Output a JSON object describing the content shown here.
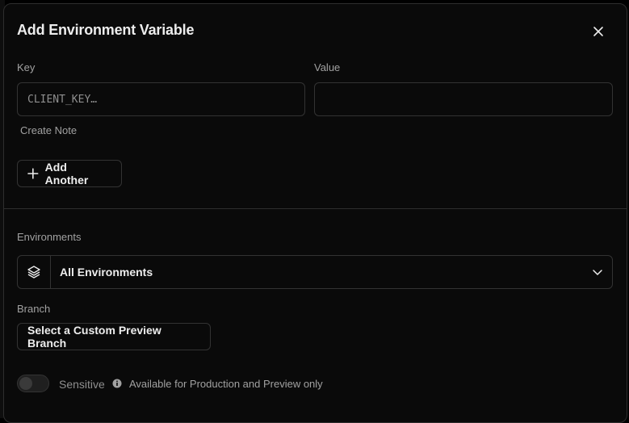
{
  "dialog": {
    "title": "Add Environment Variable",
    "close_icon": "close-icon"
  },
  "fields": {
    "key_label": "Key",
    "key_placeholder": "CLIENT_KEY…",
    "key_value": "",
    "value_label": "Value",
    "value_placeholder": "",
    "value_value": ""
  },
  "create_note": "Create Note",
  "add_another": {
    "label": "Add Another",
    "icon": "plus-icon"
  },
  "environments": {
    "label": "Environments",
    "selected": "All Environments",
    "icon": "layers-icon",
    "chevron": "chevron-down-icon"
  },
  "branch": {
    "label": "Branch",
    "button_label": "Select a Custom Preview Branch"
  },
  "sensitive": {
    "label": "Sensitive",
    "enabled": false,
    "info_icon": "info-icon",
    "note": "Available for Production and Preview only"
  },
  "colors": {
    "background": "#0a0a0a",
    "border": "#333333",
    "text": "#ededed",
    "muted": "#a1a1a1"
  }
}
